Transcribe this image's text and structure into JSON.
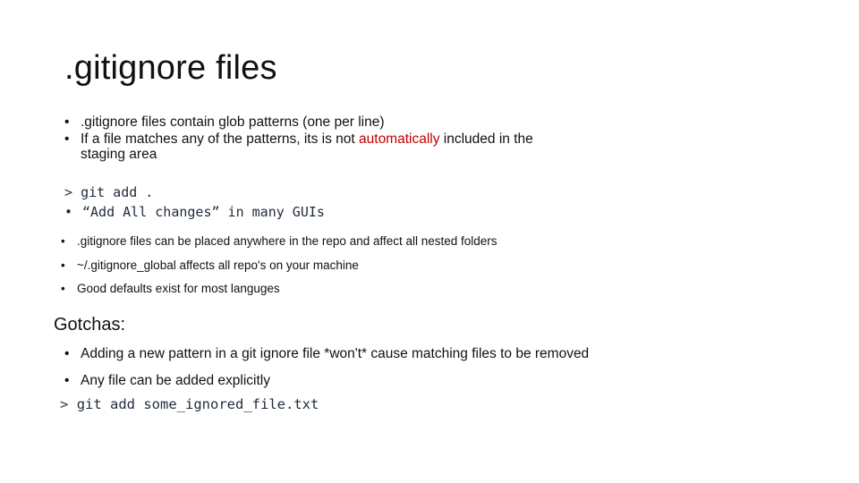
{
  "slide": {
    "title": ".gitignore files",
    "section1": {
      "bullets": [
        {
          "text": ".gitignore files contain glob patterns (one per line)"
        },
        {
          "text_before": "If a file matches any of the patterns, its is not ",
          "highlight": "automatically",
          "text_after": " included in the staging area"
        }
      ]
    },
    "code_block_1": {
      "command_prompt": ">",
      "command": "git add .",
      "bullet": "•",
      "note": "“Add All changes” in many GUIs"
    },
    "section2": {
      "bullets": [
        ".gitignore files can be placed anywhere in the repo and affect all nested folders",
        "~/.gitignore_global affects all repo's on your machine",
        "Good defaults exist for most languges"
      ]
    },
    "gotchas": {
      "heading": "Gotchas:",
      "bullets": [
        "Adding a new pattern in a git ignore file *won't* cause matching files to be removed",
        "Any file can be added explicitly"
      ],
      "command_prompt": ">",
      "command": "git add some_ignored_file.txt"
    },
    "bullet_glyph": "•",
    "colors": {
      "highlight": "#c00000",
      "code_text": "#1f2a3c",
      "body_text": "#111111",
      "background": "#ffffff"
    }
  }
}
